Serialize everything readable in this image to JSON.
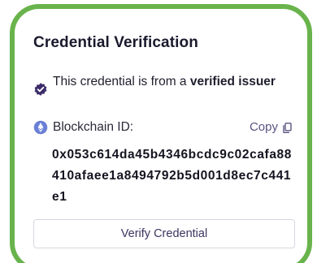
{
  "card": {
    "title": "Credential Verification",
    "verified": {
      "text_prefix": "This credential is from a ",
      "text_bold": "verified issuer"
    },
    "blockchain": {
      "label": "Blockchain ID:",
      "copy_label": "Copy",
      "id_value": "0x053c614da45b4346bcdc9c02cafa88410afaee1a8494792b5d001d8ec7c441e1"
    },
    "verify_button_label": "Verify Credential"
  },
  "colors": {
    "highlight_frame": "#69b34c",
    "badge": "#3d2d6b",
    "eth_icon": "#6a7fd6",
    "text_primary": "#1a1a2e",
    "link": "#5a5380"
  },
  "icons": {
    "verified": "verified-badge-icon",
    "chain": "ethereum-icon",
    "copy": "copy-icon"
  }
}
